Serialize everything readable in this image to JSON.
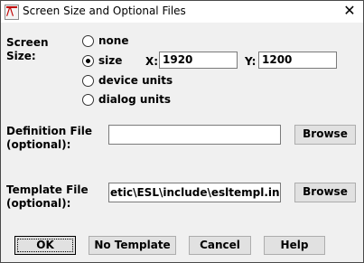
{
  "window": {
    "title": "Screen Size and Optional Files",
    "close_glyph": "✕"
  },
  "screen_size": {
    "label_line1": "Screen",
    "label_line2": "Size:",
    "options": [
      "none",
      "size",
      "device units",
      "dialog units"
    ],
    "selected": "size",
    "x_label": "X:",
    "x_value": "1920",
    "y_label": "Y:",
    "y_value": "1200"
  },
  "definition_file": {
    "label_line1": "Definition File",
    "label_line2": "(optional):",
    "value": "",
    "browse_label": "Browse"
  },
  "template_file": {
    "label_line1": "Template File",
    "label_line2": "(optional):",
    "value": "etic\\ESL\\include\\esltempl.inc",
    "browse_label": "Browse"
  },
  "buttons": {
    "ok": "OK",
    "no_template": "No Template",
    "cancel": "Cancel",
    "help": "Help"
  }
}
